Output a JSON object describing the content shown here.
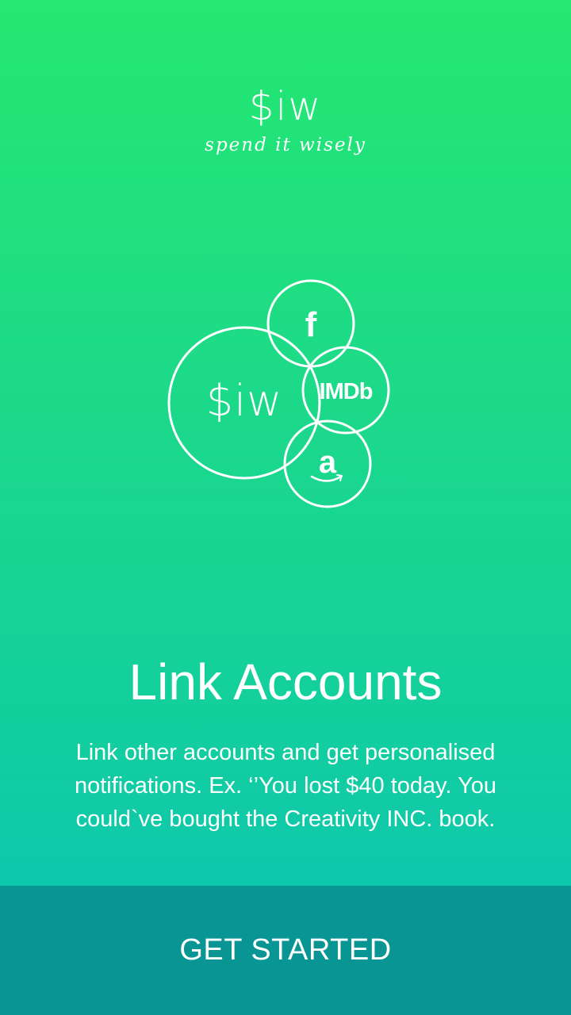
{
  "brand": {
    "logo": "$iw",
    "tagline": "spend it wisely"
  },
  "diagram": {
    "center_label": "$iw",
    "facebook_label": "f",
    "imdb_label": "IMDb",
    "amazon_label": "a",
    "icons": [
      "siw-logo-icon",
      "facebook-icon",
      "imdb-icon",
      "amazon-icon"
    ]
  },
  "onboarding": {
    "title": "Link Accounts",
    "description": "Link other accounts and get personalised notifications. Ex. ‘’You lost $40 today. You could`ve bought the Creativity INC. book."
  },
  "cta": {
    "label": "GET STARTED"
  },
  "colors": {
    "gradient_top": "#24e870",
    "gradient_bottom": "#0bc2bb",
    "cta_background": "#089594",
    "text": "#ffffff"
  }
}
